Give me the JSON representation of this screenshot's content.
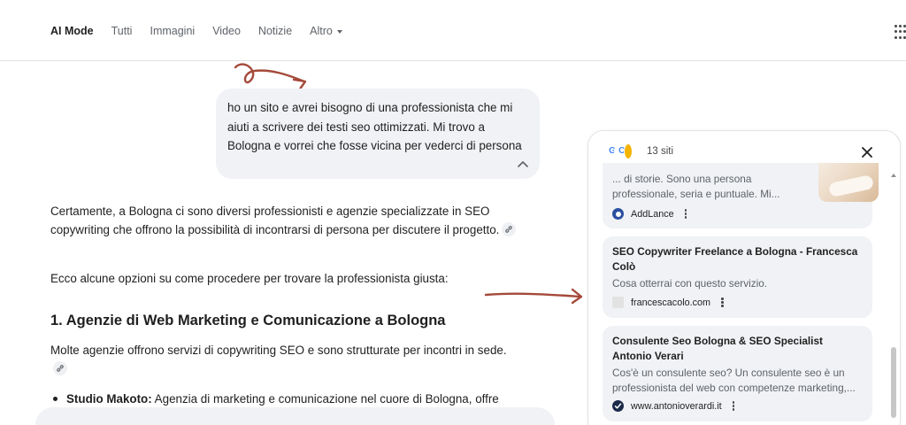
{
  "nav": {
    "tabs": [
      "AI Mode",
      "Tutti",
      "Immagini",
      "Video",
      "Notizie",
      "Altro"
    ],
    "active_index": 0
  },
  "query": {
    "text": "ho un sito e avrei bisogno di una professionista che mi aiuti a scrivere dei testi seo ottimizzati. Mi trovo a Bologna e vorrei che fosse vicina per vederci di persona"
  },
  "answer": {
    "p1": "Certamente, a Bologna ci sono diversi professionisti e agenzie specializzate in SEO copywriting che offrono la possibilità di incontrarsi di persona per discutere il progetto.",
    "p2": "Ecco alcune opzioni su come procedere per trovare la professionista giusta:",
    "heading": "1. Agenzie di Web Marketing e Comunicazione a Bologna",
    "p3": "Molte agenzie offrono servizi di copywriting SEO e sono strutturate per incontri in sede.",
    "bullet_bold": "Studio Makoto:",
    "bullet_text": " Agenzia di marketing e comunicazione nel cuore di Bologna, offre"
  },
  "sources": {
    "count_label": "13 siti",
    "cards": [
      {
        "title": "",
        "snippet": "... di storie. Sono una persona professionale, seria e puntuale. Mi...",
        "source": "AddLance",
        "source_color": "#2b4fa0"
      },
      {
        "title": "SEO Copywriter Freelance a Bologna - Francesca Colò",
        "snippet": "Cosa otterrai con questo servizio.",
        "source": "francescacolo.com",
        "source_color": "#c9c9c9"
      },
      {
        "title": "Consulente Seo Bologna & SEO Specialist Antonio Verari",
        "snippet": "Cos'è un consulente seo? Un consulente seo è un professionista del web con competenze marketing,...",
        "source": "www.antonioverardi.it",
        "source_color": "#1b2a4a"
      }
    ]
  },
  "icons": {
    "apps": "apps-grid-icon",
    "close": "close-icon",
    "collapse": "chevron-up-icon",
    "link": "link-icon",
    "more": "more-vert-icon"
  },
  "colors": {
    "accent_arrow": "#a44a3a",
    "bubble_bg": "#f0f2f5"
  }
}
